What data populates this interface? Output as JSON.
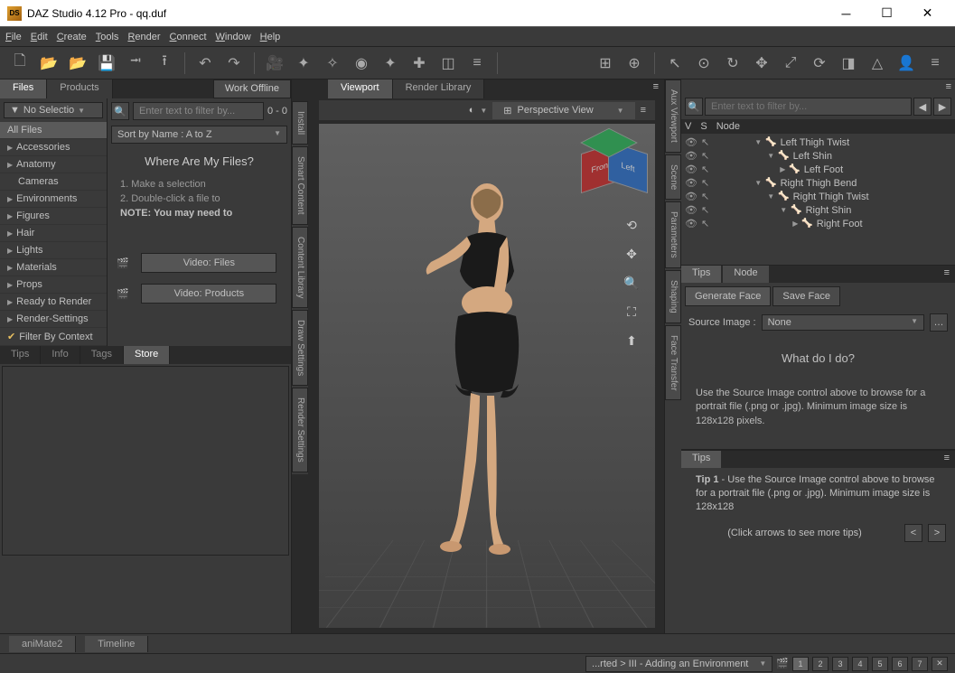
{
  "window": {
    "title": "DAZ Studio 4.12 Pro - qq.duf",
    "logo": "DS"
  },
  "menu": [
    "File",
    "Edit",
    "Create",
    "Tools",
    "Render",
    "Connect",
    "Window",
    "Help"
  ],
  "left": {
    "tabs": [
      "Files",
      "Products"
    ],
    "work_offline": "Work Offline",
    "no_selection": "No Selectio",
    "filter_placeholder": "Enter text to filter by...",
    "filter_count": "0 - 0",
    "sort": "Sort by Name : A to Z",
    "categories": [
      "All Files",
      "Accessories",
      "Anatomy",
      "Cameras",
      "Environments",
      "Figures",
      "Hair",
      "Lights",
      "Materials",
      "Props",
      "Ready to Render",
      "Render-Settings"
    ],
    "filter_ctx": "Filter By Context",
    "where": "Where Are My Files?",
    "step1": "1. Make a selection",
    "step2": "2. Double-click a file to",
    "note": "NOTE: You may need to",
    "vid1": "Video: Files",
    "vid2": "Video:  Products",
    "lowertabs": [
      "Tips",
      "Info",
      "Tags",
      "Store"
    ]
  },
  "viewport": {
    "tabs": [
      "Viewport",
      "Render Library"
    ],
    "view": "Perspective View",
    "cube": {
      "front": "Front",
      "left": "Left"
    },
    "sidetabs_left": [
      "Install",
      "Smart Content",
      "Content Library",
      "Draw Settings",
      "Render Settings"
    ],
    "sidetabs_right": [
      "Aux Viewport",
      "Scene",
      "Parameters",
      "Shaping",
      "Face Transfer"
    ]
  },
  "scene": {
    "head": [
      "V",
      "S",
      "Node"
    ],
    "filter_placeholder": "Enter text to filter by...",
    "nodes": [
      {
        "indent": 3,
        "label": "Left Thigh Twist",
        "expand": "▼"
      },
      {
        "indent": 4,
        "label": "Left Shin",
        "expand": "▼"
      },
      {
        "indent": 5,
        "label": "Left Foot",
        "expand": "▶"
      },
      {
        "indent": 3,
        "label": "Right Thigh Bend",
        "expand": "▼"
      },
      {
        "indent": 4,
        "label": "Right Thigh Twist",
        "expand": "▼"
      },
      {
        "indent": 5,
        "label": "Right Shin",
        "expand": "▼"
      },
      {
        "indent": 6,
        "label": "Right Foot",
        "expand": "▶"
      }
    ]
  },
  "params": {
    "tabs": [
      "Tips",
      "Node"
    ],
    "gen": "Generate Face",
    "save": "Save Face",
    "srclabel": "Source Image :",
    "srcval": "None",
    "whatdo": "What do I do?",
    "help": "Use the Source Image control above to browse for a portrait file (.png or .jpg). Minimum image size is 128x128 pixels."
  },
  "tips2": {
    "tab": "Tips",
    "title": "Tip 1",
    "body": " - Use the Source Image control above to browse for a portrait file (.png or .jpg). Minimum image size is 128x128",
    "more": "(Click arrows to see more tips)"
  },
  "bottom": {
    "anim": "aniMate2",
    "tl": "Timeline"
  },
  "status": {
    "path": "...rted > III - Adding an Environment",
    "pages": [
      "1",
      "2",
      "3",
      "4",
      "5",
      "6",
      "7"
    ]
  }
}
